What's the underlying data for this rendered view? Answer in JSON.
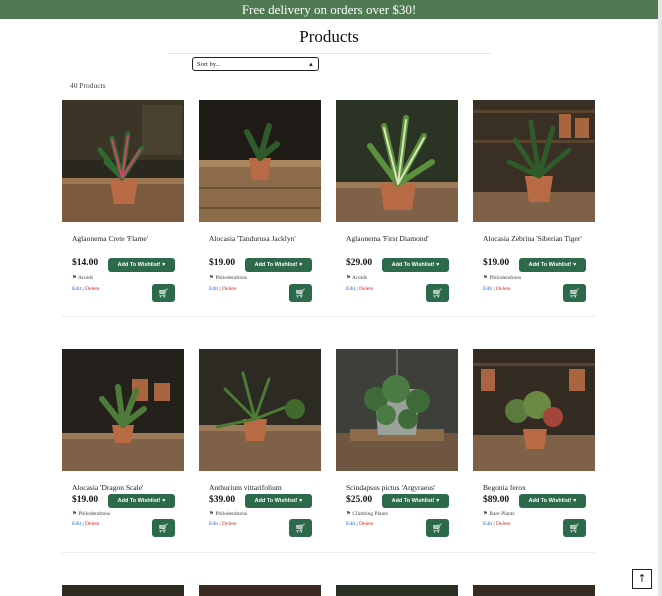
{
  "banner": {
    "text": "Free delivery on orders over $30!"
  },
  "page": {
    "title": "Products",
    "count": "40 Products"
  },
  "sort": {
    "selected": "Sort by...",
    "icon": "select-arrows-icon"
  },
  "back_to_top": {
    "icon": "arrow-up-icon",
    "glyph": "↑"
  },
  "row1": [
    {
      "name": "Aglaonema Crete 'Flame'",
      "price": "$14.00",
      "category": "Aroids",
      "wishlist": "Add To Wishlist!",
      "edit": "Edit",
      "delete": "Delete"
    },
    {
      "name": "Alocasia 'Tandurusa Jacklyn'",
      "price": "$19.00",
      "category": "Philodendrons",
      "wishlist": "Add To Wishlist!",
      "edit": "Edit",
      "delete": "Delete"
    },
    {
      "name": "Aglaonema 'First Diamond'",
      "price": "$29.00",
      "category": "Aroids",
      "wishlist": "Add To Wishlist!",
      "edit": "Edit",
      "delete": "Delete"
    },
    {
      "name": "Alocasia Zebrina 'Siberian Tiger'",
      "price": "$19.00",
      "category": "Philodendrons",
      "wishlist": "Add To Wishlist!",
      "edit": "Edit",
      "delete": "Delete"
    }
  ],
  "row2": [
    {
      "name": "Alocasia 'Dragon Scale'",
      "price": "$19.00",
      "category": "Philodendrons",
      "wishlist": "Add To Wishlist!",
      "edit": "Edit",
      "delete": "Delete"
    },
    {
      "name": "Anthurium vittarifolium",
      "price": "$39.00",
      "category": "Philodendrons",
      "wishlist": "Add To Wishlist!",
      "edit": "Edit",
      "delete": "Delete"
    },
    {
      "name": "Scindapsus pictus 'Argyraeus'",
      "price": "$25.00",
      "category": "Climbing Plants",
      "wishlist": "Add To Wishlist!",
      "edit": "Edit",
      "delete": "Delete"
    },
    {
      "name": "Begonia ferox",
      "price": "$89.00",
      "category": "Rare Plants",
      "wishlist": "Add To Wishlist!",
      "edit": "Edit",
      "delete": "Delete"
    }
  ],
  "icons": {
    "heart": "heart-icon",
    "tag": "tag-icon",
    "cart": "shopping-cart-icon"
  },
  "colors": {
    "banner": "#4f7a52",
    "button": "#2d6a4c",
    "edit_link": "#2a67c9",
    "delete_link": "#cc2b2b"
  }
}
